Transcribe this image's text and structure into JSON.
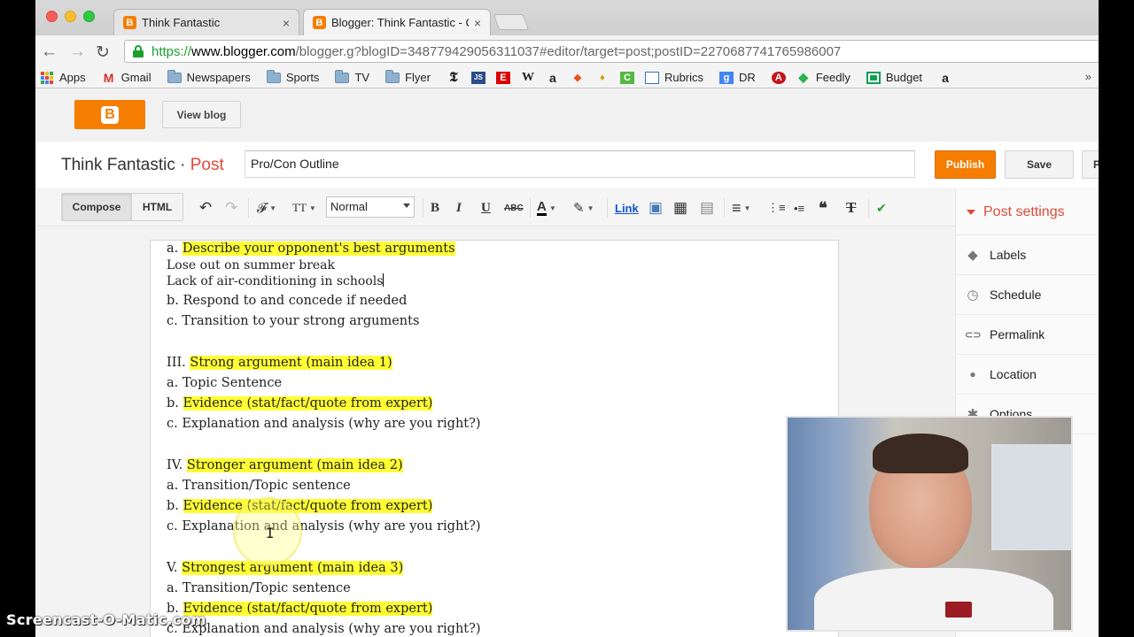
{
  "browser": {
    "tabs": [
      {
        "label": "Think Fantastic",
        "close": "×"
      },
      {
        "label": "Blogger: Think Fantastic - C",
        "close": "×"
      }
    ],
    "url": {
      "https": "https://",
      "domain": "www.blogger.com",
      "rest": "/blogger.g?blogID=348779429056311037#editor/target=post;postID=2270687741765986007"
    },
    "nav": {
      "back": "←",
      "forward": "→",
      "reload": "↻"
    },
    "bookmarks": [
      {
        "label": "Apps",
        "icon": "apps-icon"
      },
      {
        "label": "Gmail",
        "icon": "gmail-icon"
      },
      {
        "label": "Newspapers",
        "icon": "folder-icon"
      },
      {
        "label": "Sports",
        "icon": "folder-icon"
      },
      {
        "label": "TV",
        "icon": "folder-icon"
      },
      {
        "label": "Flyer",
        "icon": "folder-icon"
      },
      {
        "label": "",
        "icon": "nyt-icon"
      },
      {
        "label": "",
        "icon": "js-icon"
      },
      {
        "label": "",
        "icon": "espn-icon"
      },
      {
        "label": "",
        "icon": "wikipedia-icon"
      },
      {
        "label": "",
        "icon": "amazon-icon"
      },
      {
        "label": "",
        "icon": "fox-icon"
      },
      {
        "label": "",
        "icon": "bulb-icon"
      },
      {
        "label": "",
        "icon": "c-icon"
      },
      {
        "label": "Rubrics",
        "icon": "rubrics-icon"
      },
      {
        "label": "DR",
        "icon": "google-icon"
      },
      {
        "label": "",
        "icon": "acrobat-icon"
      },
      {
        "label": "Feedly",
        "icon": "feedly-icon"
      },
      {
        "label": "Budget",
        "icon": "sheets-icon"
      },
      {
        "label": "",
        "icon": "amazon-icon"
      }
    ],
    "bookmarks_more": "»",
    "glyphs": {
      "nyt": "𝕿",
      "js": "JS",
      "espn": "E",
      "wiki": "W",
      "amazon": "a",
      "fox": "◆",
      "bulb": "♦",
      "c": "C",
      "google": "g",
      "acrobat": "A",
      "feedly": "◆"
    }
  },
  "blogger": {
    "logo_glyph": "B",
    "view_blog": "View blog",
    "blog_name": "Think Fantastic",
    "separator": "·",
    "post_label": "Post",
    "post_title": "Pro/Con Outline",
    "publish": "Publish",
    "save": "Save",
    "preview": "P",
    "modes": {
      "compose": "Compose",
      "html": "HTML"
    },
    "format_value": "Normal",
    "toolbar": {
      "undo": "↶",
      "redo": "↷",
      "font": "𝓕",
      "size": "TT",
      "bold": "B",
      "italic": "I",
      "underline": "U",
      "strike": "ABC",
      "text_color": "A",
      "highlight": "✎",
      "link": "Link",
      "image": "▣",
      "video": "▦",
      "jump": "▤",
      "align": "≡",
      "numbered": "⋮≡",
      "bulleted": "•≡",
      "quote": "❝",
      "clear": "T",
      "spell": "✔"
    },
    "caret": "▼",
    "sidebar": {
      "title": "Post settings",
      "items": [
        {
          "label": "Labels",
          "icon": "tag-icon",
          "glyph": "◆"
        },
        {
          "label": "Schedule",
          "icon": "clock-icon",
          "glyph": "◷"
        },
        {
          "label": "Permalink",
          "icon": "link-icon",
          "glyph": "⊂⊃"
        },
        {
          "label": "Location",
          "icon": "pin-icon",
          "glyph": "●"
        },
        {
          "label": "Options",
          "icon": "gear-icon",
          "glyph": "✱"
        }
      ]
    }
  },
  "document": {
    "lines": [
      {
        "prefix": "a.  ",
        "text": "Describe your opponent's best arguments",
        "highlight": true
      },
      {
        "prefix": "",
        "text": "Lose out on summer break",
        "highlight": false
      },
      {
        "prefix": "",
        "text": "Lack of air-conditioning in schools",
        "highlight": false
      },
      {
        "prefix": "b.  ",
        "text": "Respond to and concede if needed",
        "highlight": false
      },
      {
        "prefix": "c.  ",
        "text": "Transition to your strong arguments",
        "highlight": false
      },
      {
        "prefix": "III.  ",
        "text": "Strong argument (main idea 1)",
        "highlight": true
      },
      {
        "prefix": "a. ",
        "text": "Topic Sentence",
        "highlight": false
      },
      {
        "prefix": "b. ",
        "text": "Evidence (stat/fact/quote from expert)",
        "highlight": true
      },
      {
        "prefix": "c. ",
        "text": "Explanation and analysis (why are you right?)",
        "highlight": false
      },
      {
        "prefix": "IV.  ",
        "text": "Stronger argument (main idea 2)",
        "highlight": true
      },
      {
        "prefix": "a.  ",
        "text": "Transition/Topic sentence",
        "highlight": false
      },
      {
        "prefix": "b. ",
        "text": "Evidence (stat/fact/quote from expert)",
        "highlight": true
      },
      {
        "prefix": "c. ",
        "text": "Explanation and analysis (why are you right?)",
        "highlight": false
      },
      {
        "prefix": "V.  ",
        "text": "Strongest argument (main idea 3)",
        "highlight": true
      },
      {
        "prefix": "a.  ",
        "text": "Transition/Topic sentence",
        "highlight": false
      },
      {
        "prefix": "b. ",
        "text": "Evidence (stat/fact/quote from expert)",
        "highlight": true
      },
      {
        "prefix": "c. ",
        "text": "Explanation and analysis (why are you right?)",
        "highlight": false
      }
    ]
  },
  "watermark": "Screencast-O-Matic.com",
  "colors": {
    "blogger_orange": "#f57d00",
    "post_red": "#dd4b39",
    "highlight": "#ffff33",
    "link_blue": "#15c"
  }
}
